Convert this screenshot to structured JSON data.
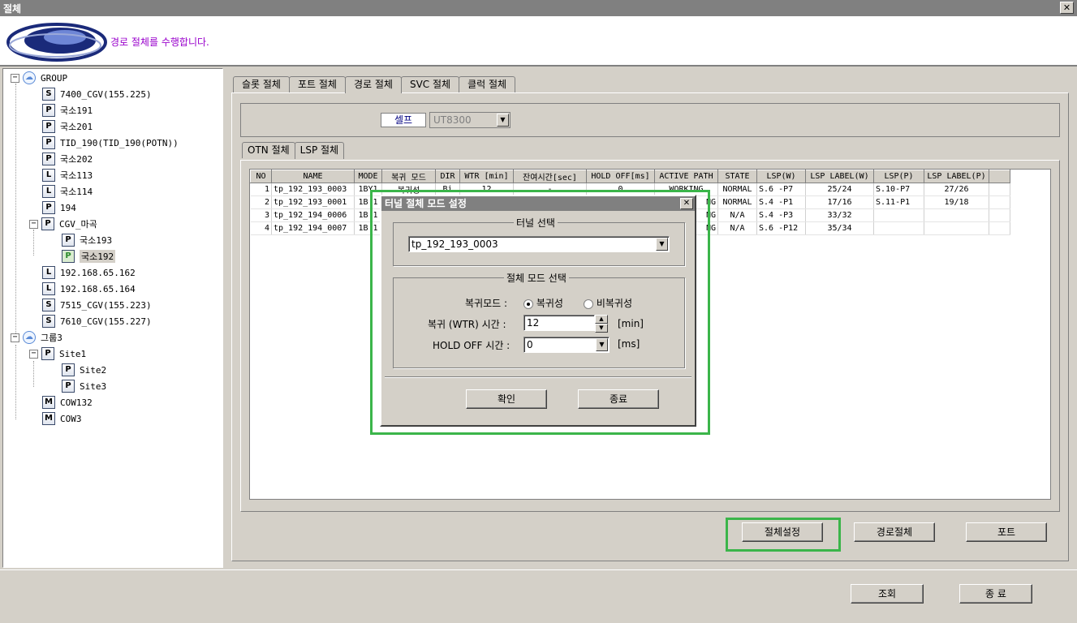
{
  "window": {
    "title": "절체",
    "close_icon": "close-icon"
  },
  "banner": {
    "message": "경로 절체를 수행합니다."
  },
  "tree": {
    "nodes": [
      {
        "label": "GROUP",
        "icon": "cloud"
      },
      {
        "label": "7400_CGV(155.225)",
        "icon": "S"
      },
      {
        "label": "국소191",
        "icon": "P"
      },
      {
        "label": "국소201",
        "icon": "P"
      },
      {
        "label": "TID_190(TID_190(POTN))",
        "icon": "P"
      },
      {
        "label": "국소202",
        "icon": "P"
      },
      {
        "label": "국소113",
        "icon": "L"
      },
      {
        "label": "국소114",
        "icon": "L"
      },
      {
        "label": "194",
        "icon": "P"
      },
      {
        "label": "CGV_마곡",
        "icon": "P"
      },
      {
        "label": "국소193",
        "icon": "P"
      },
      {
        "label": "국소192",
        "icon": "P"
      },
      {
        "label": "192.168.65.162",
        "icon": "L"
      },
      {
        "label": "192.168.65.164",
        "icon": "L"
      },
      {
        "label": "7515_CGV(155.223)",
        "icon": "S"
      },
      {
        "label": "7610_CGV(155.227)",
        "icon": "S"
      },
      {
        "label": "그룹3",
        "icon": "cloud"
      },
      {
        "label": "Site1",
        "icon": "P"
      },
      {
        "label": "Site2",
        "icon": "P"
      },
      {
        "label": "Site3",
        "icon": "P"
      },
      {
        "label": "COW132",
        "icon": "M"
      },
      {
        "label": "COW3",
        "icon": "M"
      }
    ]
  },
  "tabs": [
    {
      "label": "슬롯 절체"
    },
    {
      "label": "포트 절체"
    },
    {
      "label": "경로 절체"
    },
    {
      "label": "SVC 절체"
    },
    {
      "label": "클럭 절체"
    }
  ],
  "selp": {
    "label": "셀프",
    "value": "UT8300"
  },
  "subtabs": [
    {
      "label": "OTN 절체"
    },
    {
      "label": "LSP 절체"
    }
  ],
  "grid": {
    "headers": [
      "NO",
      "NAME",
      "MODE",
      "복귀 모드",
      "DIR",
      "WTR [min]",
      "잔여시간[sec]",
      "HOLD OFF[ms]",
      "ACTIVE PATH",
      "STATE",
      "LSP(W)",
      "LSP LABEL(W)",
      "LSP(P)",
      "LSP LABEL(P)",
      ""
    ],
    "rows": [
      [
        "1",
        "tp_192_193_0003",
        "1BY1",
        "복귀성",
        "Bi",
        "12",
        "-",
        "0",
        "WORKING",
        "NORMAL",
        "S.6 -P7",
        "25/24",
        "S.10-P7",
        "27/26",
        ""
      ],
      [
        "2",
        "tp_192_193_0001",
        "1B'1",
        "",
        "",
        "",
        "",
        "",
        "NG",
        "NORMAL",
        "S.4 -P1",
        "17/16",
        "S.11-P1",
        "19/18",
        ""
      ],
      [
        "3",
        "tp_192_194_0006",
        "1B'1",
        "",
        "",
        "",
        "",
        "",
        "NG",
        "N/A",
        "S.4 -P3",
        "33/32",
        "",
        "",
        ""
      ],
      [
        "4",
        "tp_192_194_0007",
        "1B'1",
        "",
        "",
        "",
        "",
        "",
        "NG",
        "N/A",
        "S.6 -P12",
        "35/34",
        "",
        "",
        ""
      ]
    ]
  },
  "buttons": {
    "setting": "절체설정",
    "path_switch": "경로절체",
    "port": "포트",
    "query": "조회",
    "exit": "종 료"
  },
  "dialog": {
    "title": "터널 절체 모드 설정",
    "tunnel_group": "터널 선택",
    "tunnel_value": "tp_192_193_0003",
    "mode_group": "절체 모드 선택",
    "restore_mode_label": "복귀모드 :",
    "restore_option_on": "복귀성",
    "restore_option_off": "비복귀성",
    "wtr_label": "복귀 (WTR) 시간 :",
    "wtr_value": "12",
    "wtr_unit": "[min]",
    "holdoff_label": "HOLD OFF 시간 :",
    "holdoff_value": "0",
    "holdoff_unit": "[ms]",
    "ok": "확인",
    "close": "종료"
  },
  "colors": {
    "highlight": "#3bb54a",
    "banner_text": "#9900cc",
    "titlebar": "#808080"
  }
}
